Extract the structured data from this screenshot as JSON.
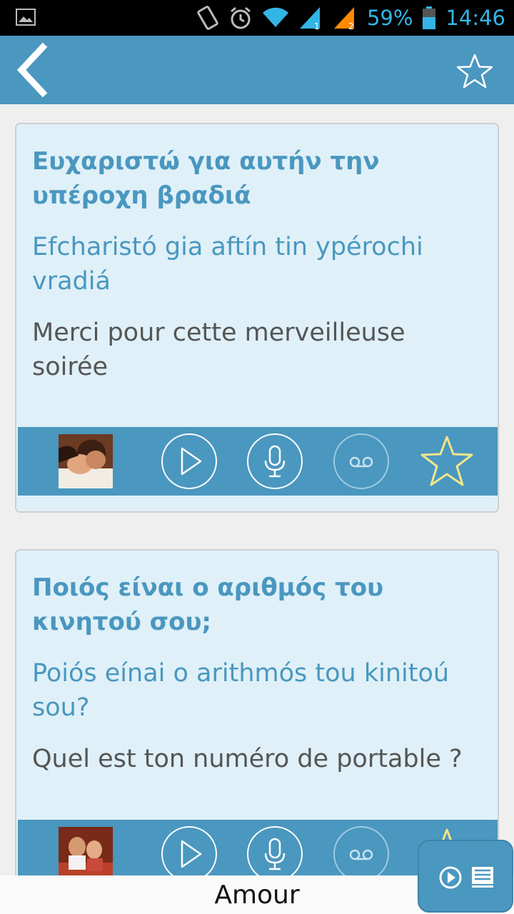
{
  "status_bar": {
    "battery": "59%",
    "time": "14:46",
    "sim1_label": "1",
    "sim2_label": "2",
    "icons": [
      "gallery-icon",
      "vibrate-icon",
      "alarm-icon",
      "wifi-icon",
      "signal-icon",
      "signal-icon",
      "battery-icon"
    ]
  },
  "action_bar": {
    "back_icon": "chevron-left-icon",
    "favorite_icon": "star-outline-icon"
  },
  "phrases": [
    {
      "greek": "Ευχαριστώ για αυτήν την υπέροχη βραδιά",
      "transliteration": "Efcharistó gia aftín tin ypérochi vradiá",
      "translation": "Merci pour cette merveilleuse soirée",
      "image": "couple-embrace-photo",
      "actions": [
        "play-icon",
        "microphone-icon",
        "voicemail-icon",
        "star-outline-icon"
      ],
      "colors": {
        "star": "#f0e68c"
      }
    },
    {
      "greek": "Ποιός είναι ο αριθμός του κινητού σου;",
      "transliteration": "Poiós eínai o arithmós tou kinitoú sou?",
      "translation": "Quel est ton numéro de portable ?",
      "image": "couple-dinner-photo",
      "actions": [
        "play-icon",
        "microphone-icon",
        "voicemail-icon",
        "star-outline-icon"
      ]
    }
  ],
  "bottom": {
    "title": "Amour",
    "floating_icons": [
      "play-icon",
      "list-icon"
    ]
  },
  "colors": {
    "accent": "#4a97bf",
    "card_bg": "#dff0f8",
    "status_blue": "#33b5e5",
    "star_yellow": "#f0e68c"
  }
}
